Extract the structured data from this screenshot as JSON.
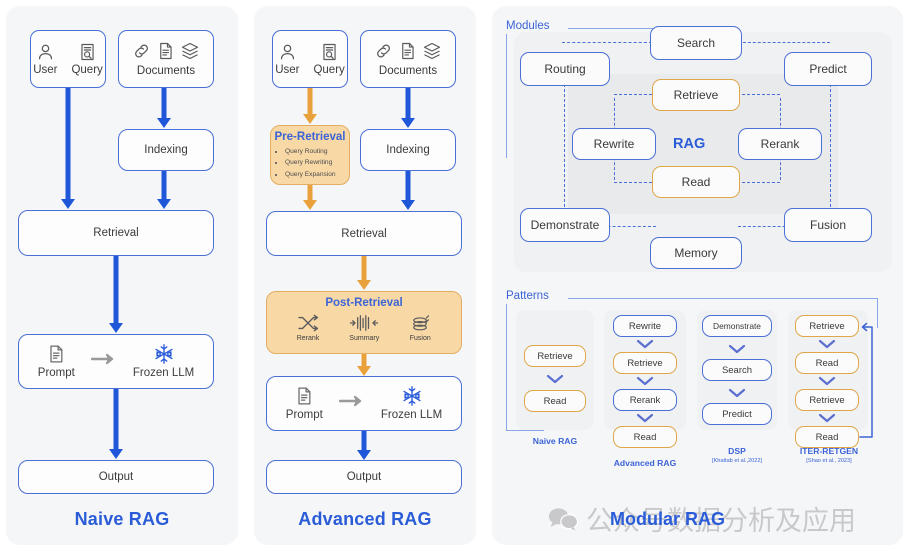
{
  "columns": {
    "naive": {
      "caption": "Naive RAG",
      "nodes": {
        "user": "User",
        "query": "Query",
        "documents": "Documents",
        "indexing": "Indexing",
        "retrieval": "Retrieval",
        "prompt": "Prompt",
        "frozen_llm": "Frozen LLM",
        "output": "Output"
      },
      "icons": {
        "user": "user-icon",
        "query": "query-document-icon",
        "link": "link-icon",
        "document": "document-icon",
        "layers": "layers-icon",
        "prompt": "prompt-document-icon",
        "arrow": "right-arrow-icon",
        "snowflake": "snowflake-icon"
      }
    },
    "advanced": {
      "caption": "Advanced RAG",
      "nodes": {
        "user": "User",
        "query": "Query",
        "documents": "Documents",
        "indexing": "Indexing",
        "retrieval": "Retrieval",
        "prompt": "Prompt",
        "frozen_llm": "Frozen LLM",
        "output": "Output"
      },
      "pre_retrieval": {
        "title": "Pre-Retrieval",
        "bullets": [
          "Query Routing",
          "Query Rewriting",
          "Query Expansion"
        ]
      },
      "post_retrieval": {
        "title": "Post-Retrieval",
        "items": [
          {
            "label": "Rerank",
            "icon": "shuffle-icon"
          },
          {
            "label": "Summary",
            "icon": "compress-icon"
          },
          {
            "label": "Fusion",
            "icon": "fusion-icon"
          }
        ]
      }
    },
    "modular": {
      "caption": "Modular RAG",
      "modules": {
        "label": "Modules",
        "center": "RAG",
        "outer": [
          "Search",
          "Routing",
          "Predict",
          "Demonstrate",
          "Fusion",
          "Memory"
        ],
        "inner": [
          "Retrieve",
          "Rewrite",
          "Rerank",
          "Read"
        ],
        "nodes": {
          "search": "Search",
          "routing": "Routing",
          "predict": "Predict",
          "retrieve": "Retrieve",
          "rewrite": "Rewrite",
          "rerank": "Rerank",
          "read": "Read",
          "demonstrate": "Demonstrate",
          "fusion": "Fusion",
          "memory": "Memory"
        }
      },
      "patterns": {
        "label": "Patterns",
        "columns": [
          {
            "name": "Naive RAG",
            "citation": "",
            "steps": [
              {
                "label": "Retrieve",
                "style": "orange"
              },
              {
                "label": "Read",
                "style": "orange"
              }
            ]
          },
          {
            "name": "Advanced RAG",
            "citation": "",
            "steps": [
              {
                "label": "Rewrite",
                "style": "blue"
              },
              {
                "label": "Retrieve",
                "style": "orange"
              },
              {
                "label": "Rerank",
                "style": "blue"
              },
              {
                "label": "Read",
                "style": "orange"
              }
            ]
          },
          {
            "name": "DSP",
            "citation": "[Khattab et al.,2022]",
            "steps": [
              {
                "label": "Demonstrate",
                "style": "blue"
              },
              {
                "label": "Search",
                "style": "blue"
              },
              {
                "label": "Predict",
                "style": "blue"
              }
            ]
          },
          {
            "name": "ITER-RETGEN",
            "citation": "[Shao et al., 2023]",
            "steps": [
              {
                "label": "Retrieve",
                "style": "orange"
              },
              {
                "label": "Read",
                "style": "orange"
              },
              {
                "label": "Retrieve",
                "style": "orange"
              },
              {
                "label": "Read",
                "style": "orange"
              }
            ],
            "feedback_loop": true
          }
        ]
      }
    }
  },
  "watermark": {
    "text": "公众号数据分析及应用",
    "icon": "wechat-icon"
  },
  "colors": {
    "accent_blue": "#2a5cd8",
    "node_blue": "#4a6fd6",
    "node_orange": "#e0a64a",
    "arrow_blue": "#2057d8",
    "arrow_orange": "#e9a23b",
    "tint_orange": "#f8d9a6",
    "panel_bg": "#f5f6f8"
  }
}
